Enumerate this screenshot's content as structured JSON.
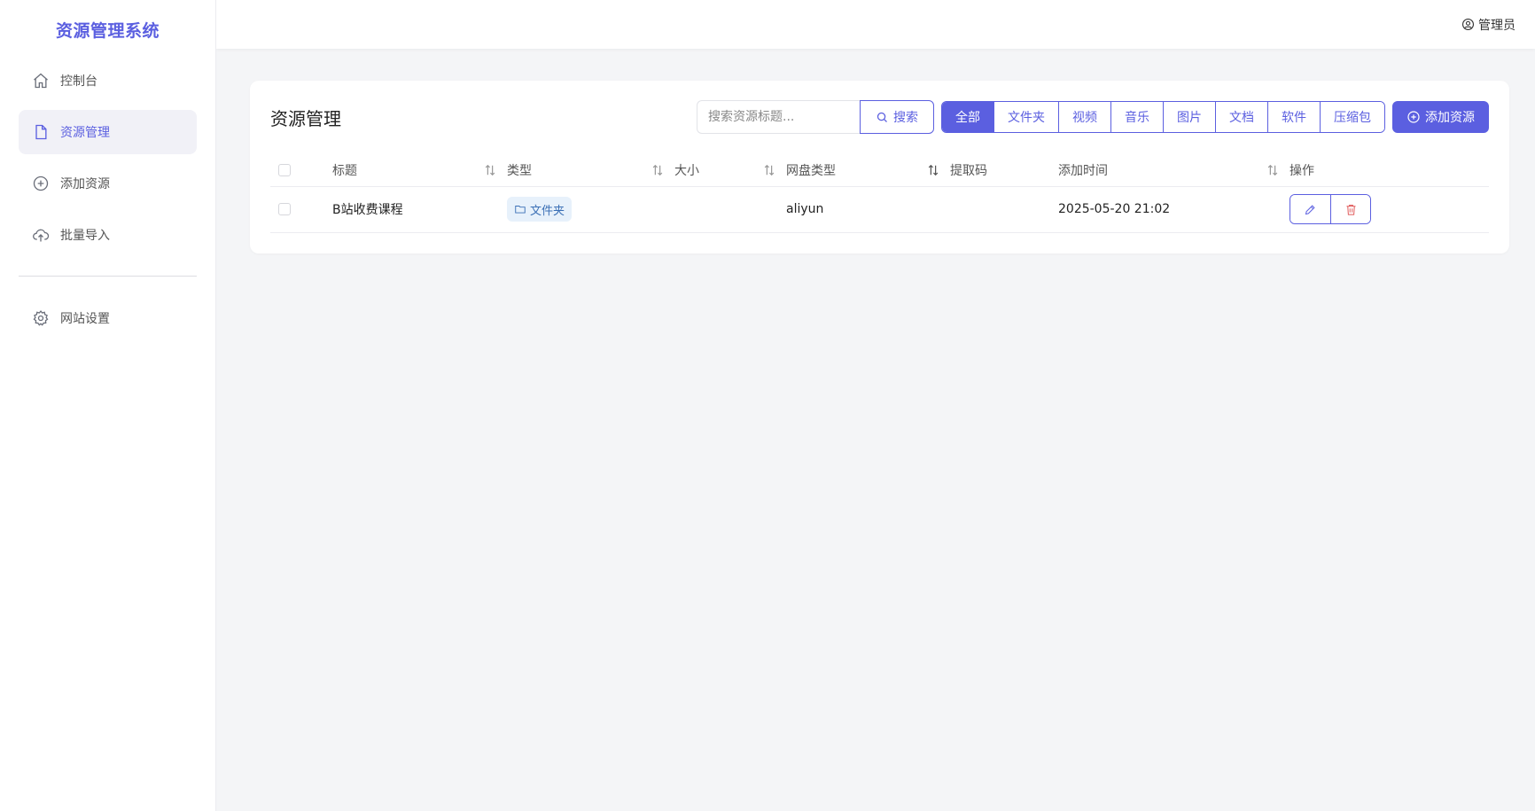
{
  "brand": {
    "title": "资源管理系统",
    "accent": "#5b5fe0"
  },
  "sidebar": {
    "items": [
      {
        "label": "控制台",
        "icon": "home-icon",
        "active": false
      },
      {
        "label": "资源管理",
        "icon": "file-icon",
        "active": true
      },
      {
        "label": "添加资源",
        "icon": "plus-circle-icon",
        "active": false
      },
      {
        "label": "批量导入",
        "icon": "cloud-upload-icon",
        "active": false
      }
    ],
    "bottom_items": [
      {
        "label": "网站设置",
        "icon": "gear-icon",
        "active": false
      }
    ]
  },
  "header": {
    "user_label": "管理员",
    "user_icon": "user-circle-icon"
  },
  "page": {
    "title": "资源管理",
    "search": {
      "placeholder": "搜索资源标题...",
      "value": "",
      "button_label": "搜索"
    },
    "filters": [
      {
        "label": "全部",
        "active": true
      },
      {
        "label": "文件夹",
        "active": false
      },
      {
        "label": "视频",
        "active": false
      },
      {
        "label": "音乐",
        "active": false
      },
      {
        "label": "图片",
        "active": false
      },
      {
        "label": "文档",
        "active": false
      },
      {
        "label": "软件",
        "active": false
      },
      {
        "label": "压缩包",
        "active": false
      }
    ],
    "add_button_label": "添加资源"
  },
  "table": {
    "columns": {
      "title": "标题",
      "type": "类型",
      "size": "大小",
      "pan_type": "网盘类型",
      "code": "提取码",
      "added_time": "添加时间",
      "actions": "操作"
    },
    "rows": [
      {
        "title": "B站收费课程",
        "type": "文件夹",
        "size": "",
        "pan_type": "aliyun",
        "code": "",
        "added_time": "2025-05-20 21:02"
      }
    ]
  }
}
